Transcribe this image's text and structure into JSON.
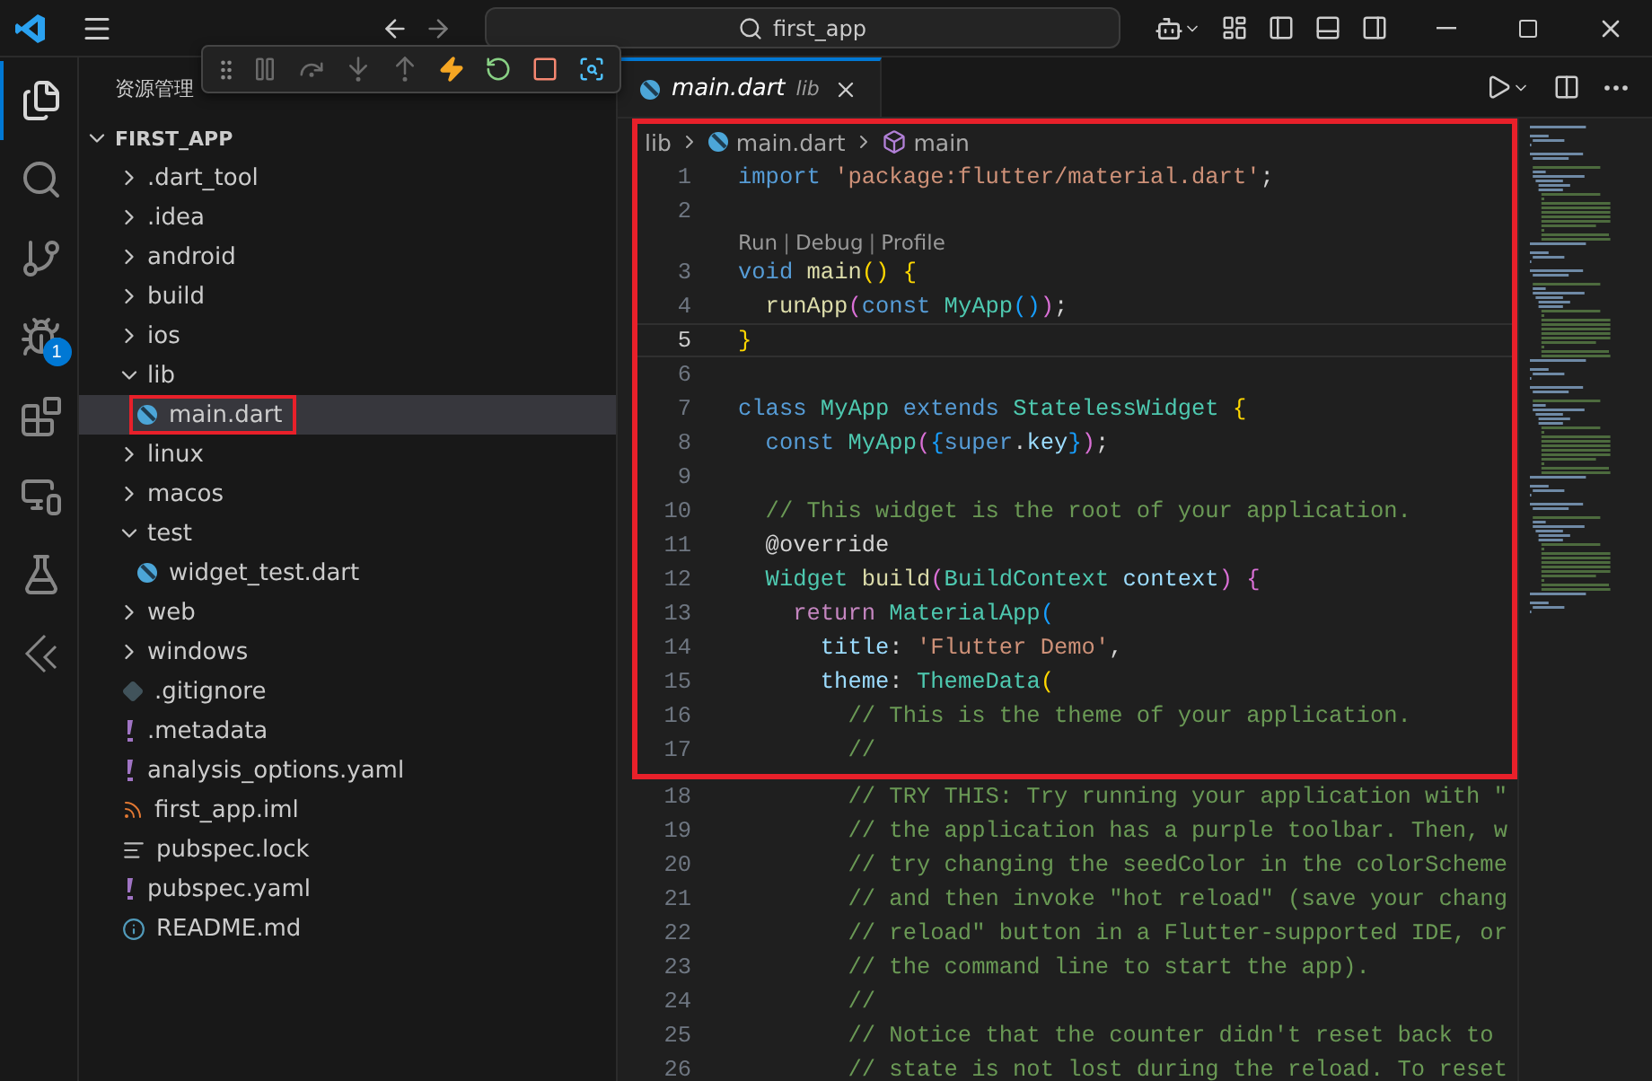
{
  "title_bar": {
    "search": "first_app"
  },
  "activity_bar": [
    {
      "kind": "explorer",
      "selected": true
    },
    {
      "kind": "search",
      "selected": false
    },
    {
      "kind": "scm",
      "selected": false
    },
    {
      "kind": "debug",
      "selected": false,
      "badge": "1"
    },
    {
      "kind": "extensions",
      "selected": false
    },
    {
      "kind": "remote",
      "selected": false
    },
    {
      "kind": "testing",
      "selected": false
    },
    {
      "kind": "flutter",
      "selected": false
    }
  ],
  "debug_toolbar": [
    {
      "kind": "grip"
    },
    {
      "kind": "pause",
      "disabled": true
    },
    {
      "kind": "step_over",
      "disabled": true
    },
    {
      "kind": "step_into",
      "disabled": true
    },
    {
      "kind": "step_out",
      "disabled": true
    },
    {
      "kind": "hot_reload",
      "disabled": false
    },
    {
      "kind": "restart",
      "disabled": false
    },
    {
      "kind": "stop",
      "disabled": false
    },
    {
      "kind": "inspect",
      "disabled": false
    }
  ],
  "sidebar": {
    "title": "资源管理",
    "root": {
      "label": "FIRST_APP",
      "expanded": true
    },
    "items": [
      {
        "label": ".dart_tool",
        "kind": "folder",
        "expanded": false,
        "selected": false
      },
      {
        "label": ".idea",
        "kind": "folder",
        "expanded": false,
        "selected": false
      },
      {
        "label": "android",
        "kind": "folder",
        "expanded": false,
        "selected": false
      },
      {
        "label": "build",
        "kind": "folder",
        "expanded": false,
        "selected": false
      },
      {
        "label": "ios",
        "kind": "folder",
        "expanded": false,
        "selected": false
      },
      {
        "label": "lib",
        "kind": "folder",
        "expanded": true,
        "selected": false,
        "children": [
          {
            "label": "main.dart",
            "kind": "dart",
            "selected": true,
            "annotated": true
          }
        ]
      },
      {
        "label": "linux",
        "kind": "folder",
        "expanded": false,
        "selected": false
      },
      {
        "label": "macos",
        "kind": "folder",
        "expanded": false,
        "selected": false
      },
      {
        "label": "test",
        "kind": "folder",
        "expanded": true,
        "selected": false,
        "children": [
          {
            "label": "widget_test.dart",
            "kind": "dart",
            "selected": false,
            "annotated": false
          }
        ]
      },
      {
        "label": "web",
        "kind": "folder",
        "expanded": false,
        "selected": false
      },
      {
        "label": "windows",
        "kind": "folder",
        "expanded": false,
        "selected": false
      },
      {
        "label": ".gitignore",
        "kind": "git",
        "selected": false
      },
      {
        "label": ".metadata",
        "kind": "yaml",
        "selected": false
      },
      {
        "label": "analysis_options.yaml",
        "kind": "yaml",
        "selected": false
      },
      {
        "label": "first_app.iml",
        "kind": "rss",
        "selected": false
      },
      {
        "label": "pubspec.lock",
        "kind": "lock",
        "selected": false
      },
      {
        "label": "pubspec.yaml",
        "kind": "yaml",
        "selected": false
      },
      {
        "label": "README.md",
        "kind": "info",
        "selected": false
      }
    ]
  },
  "tabs": [
    {
      "label": "main.dart",
      "description": "lib",
      "selected": true
    }
  ],
  "breadcrumb": [
    {
      "label": "lib",
      "kind": "folder"
    },
    {
      "label": "main.dart",
      "kind": "dart"
    },
    {
      "label": "main",
      "kind": "symbol"
    }
  ],
  "annotated_lines": [
    {
      "kind": "code",
      "number": "1",
      "current": false,
      "tokens": [
        {
          "text": "import ",
          "kind": "kw"
        },
        {
          "text": "'package:flutter/material.dart'",
          "kind": "str"
        },
        {
          "text": ";",
          "kind": "p"
        }
      ]
    },
    {
      "kind": "code",
      "number": "2",
      "current": false
    },
    {
      "kind": "codelens",
      "items": [
        {
          "text": "Run",
          "kind": "link"
        },
        {
          "text": "|",
          "kind": "sep"
        },
        {
          "text": "Debug",
          "kind": "link"
        },
        {
          "text": "|",
          "kind": "sep"
        },
        {
          "text": "Profile",
          "kind": "link"
        }
      ]
    },
    {
      "kind": "code",
      "number": "3",
      "current": false,
      "tokens": [
        {
          "text": "void ",
          "kind": "kw"
        },
        {
          "text": "main",
          "kind": "fn"
        },
        {
          "text": "() {",
          "kind": "b1"
        }
      ]
    },
    {
      "kind": "code",
      "number": "4",
      "current": false,
      "tokens": [
        {
          "text": "  runApp",
          "kind": "fn"
        },
        {
          "text": "(",
          "kind": "b2"
        },
        {
          "text": "const ",
          "kind": "kw"
        },
        {
          "text": "MyApp",
          "kind": "cls"
        },
        {
          "text": "()",
          "kind": "b3"
        },
        {
          "text": ")",
          "kind": "b2"
        },
        {
          "text": ";",
          "kind": "p"
        }
      ]
    },
    {
      "kind": "code",
      "number": "5",
      "current": true,
      "tokens": [
        {
          "text": "}",
          "kind": "b1"
        }
      ]
    },
    {
      "kind": "code",
      "number": "6",
      "current": false
    },
    {
      "kind": "code",
      "number": "7",
      "current": false,
      "tokens": [
        {
          "text": "class ",
          "kind": "kw"
        },
        {
          "text": "MyApp ",
          "kind": "cls"
        },
        {
          "text": "extends ",
          "kind": "kw"
        },
        {
          "text": "StatelessWidget ",
          "kind": "cls"
        },
        {
          "text": "{",
          "kind": "b1"
        }
      ]
    },
    {
      "kind": "code",
      "number": "8",
      "current": false,
      "tokens": [
        {
          "text": "  const ",
          "kind": "kw"
        },
        {
          "text": "MyApp",
          "kind": "cls"
        },
        {
          "text": "(",
          "kind": "b2"
        },
        {
          "text": "{",
          "kind": "b3"
        },
        {
          "text": "super",
          "kind": "kw"
        },
        {
          "text": ".",
          "kind": "p"
        },
        {
          "text": "key",
          "kind": "var"
        },
        {
          "text": "}",
          "kind": "b3"
        },
        {
          "text": ")",
          "kind": "b2"
        },
        {
          "text": ";",
          "kind": "p"
        }
      ]
    },
    {
      "kind": "code",
      "number": "9",
      "current": false
    },
    {
      "kind": "code",
      "number": "10",
      "current": false,
      "tokens": [
        {
          "text": "  // This widget is the root of your application.",
          "kind": "cm"
        }
      ]
    },
    {
      "kind": "code",
      "number": "11",
      "current": false,
      "tokens": [
        {
          "text": "  @override",
          "kind": "p"
        }
      ]
    },
    {
      "kind": "code",
      "number": "12",
      "current": false,
      "tokens": [
        {
          "text": "  Widget ",
          "kind": "cls"
        },
        {
          "text": "build",
          "kind": "fn"
        },
        {
          "text": "(",
          "kind": "b2"
        },
        {
          "text": "BuildContext ",
          "kind": "cls"
        },
        {
          "text": "context",
          "kind": "var"
        },
        {
          "text": ") {",
          "kind": "b2"
        }
      ]
    },
    {
      "kind": "code",
      "number": "13",
      "current": false,
      "tokens": [
        {
          "text": "    return ",
          "kind": "ctl"
        },
        {
          "text": "MaterialApp",
          "kind": "cls"
        },
        {
          "text": "(",
          "kind": "b3"
        }
      ]
    },
    {
      "kind": "code",
      "number": "14",
      "current": false,
      "tokens": [
        {
          "text": "      title",
          "kind": "var"
        },
        {
          "text": ": ",
          "kind": "p"
        },
        {
          "text": "'Flutter Demo'",
          "kind": "str"
        },
        {
          "text": ",",
          "kind": "p"
        }
      ]
    },
    {
      "kind": "code",
      "number": "15",
      "current": false,
      "tokens": [
        {
          "text": "      theme",
          "kind": "var"
        },
        {
          "text": ": ",
          "kind": "p"
        },
        {
          "text": "ThemeData",
          "kind": "cls"
        },
        {
          "text": "(",
          "kind": "b1"
        }
      ]
    },
    {
      "kind": "code",
      "number": "16",
      "current": false,
      "tokens": [
        {
          "text": "        // This is the theme of your application.",
          "kind": "cm"
        }
      ]
    },
    {
      "kind": "code",
      "number": "17",
      "current": false,
      "tokens": [
        {
          "text": "        //",
          "kind": "cm"
        }
      ]
    }
  ],
  "lines": [
    {
      "kind": "code",
      "number": "18",
      "current": false,
      "tokens": [
        {
          "text": "        // TRY THIS: Try running your application with \"",
          "kind": "cm"
        }
      ]
    },
    {
      "kind": "code",
      "number": "19",
      "current": false,
      "tokens": [
        {
          "text": "        // the application has a purple toolbar. Then, w",
          "kind": "cm"
        }
      ]
    },
    {
      "kind": "code",
      "number": "20",
      "current": false,
      "tokens": [
        {
          "text": "        // try changing the seedColor in the colorScheme",
          "kind": "cm"
        }
      ]
    },
    {
      "kind": "code",
      "number": "21",
      "current": false,
      "tokens": [
        {
          "text": "        // and then invoke \"hot reload\" (save your chang",
          "kind": "cm"
        }
      ]
    },
    {
      "kind": "code",
      "number": "22",
      "current": false,
      "tokens": [
        {
          "text": "        // reload\" button in a Flutter-supported IDE, or",
          "kind": "cm"
        }
      ]
    },
    {
      "kind": "code",
      "number": "23",
      "current": false,
      "tokens": [
        {
          "text": "        // the command line to start the app).",
          "kind": "cm"
        }
      ]
    },
    {
      "kind": "code",
      "number": "24",
      "current": false,
      "tokens": [
        {
          "text": "        //",
          "kind": "cm"
        }
      ]
    },
    {
      "kind": "code",
      "number": "25",
      "current": false,
      "tokens": [
        {
          "text": "        // Notice that the counter didn't reset back to",
          "kind": "cm"
        }
      ]
    },
    {
      "kind": "code",
      "number": "26",
      "current": false,
      "tokens": [
        {
          "text": "        // state is not lost during the reload. To reset",
          "kind": "cm"
        }
      ]
    }
  ]
}
